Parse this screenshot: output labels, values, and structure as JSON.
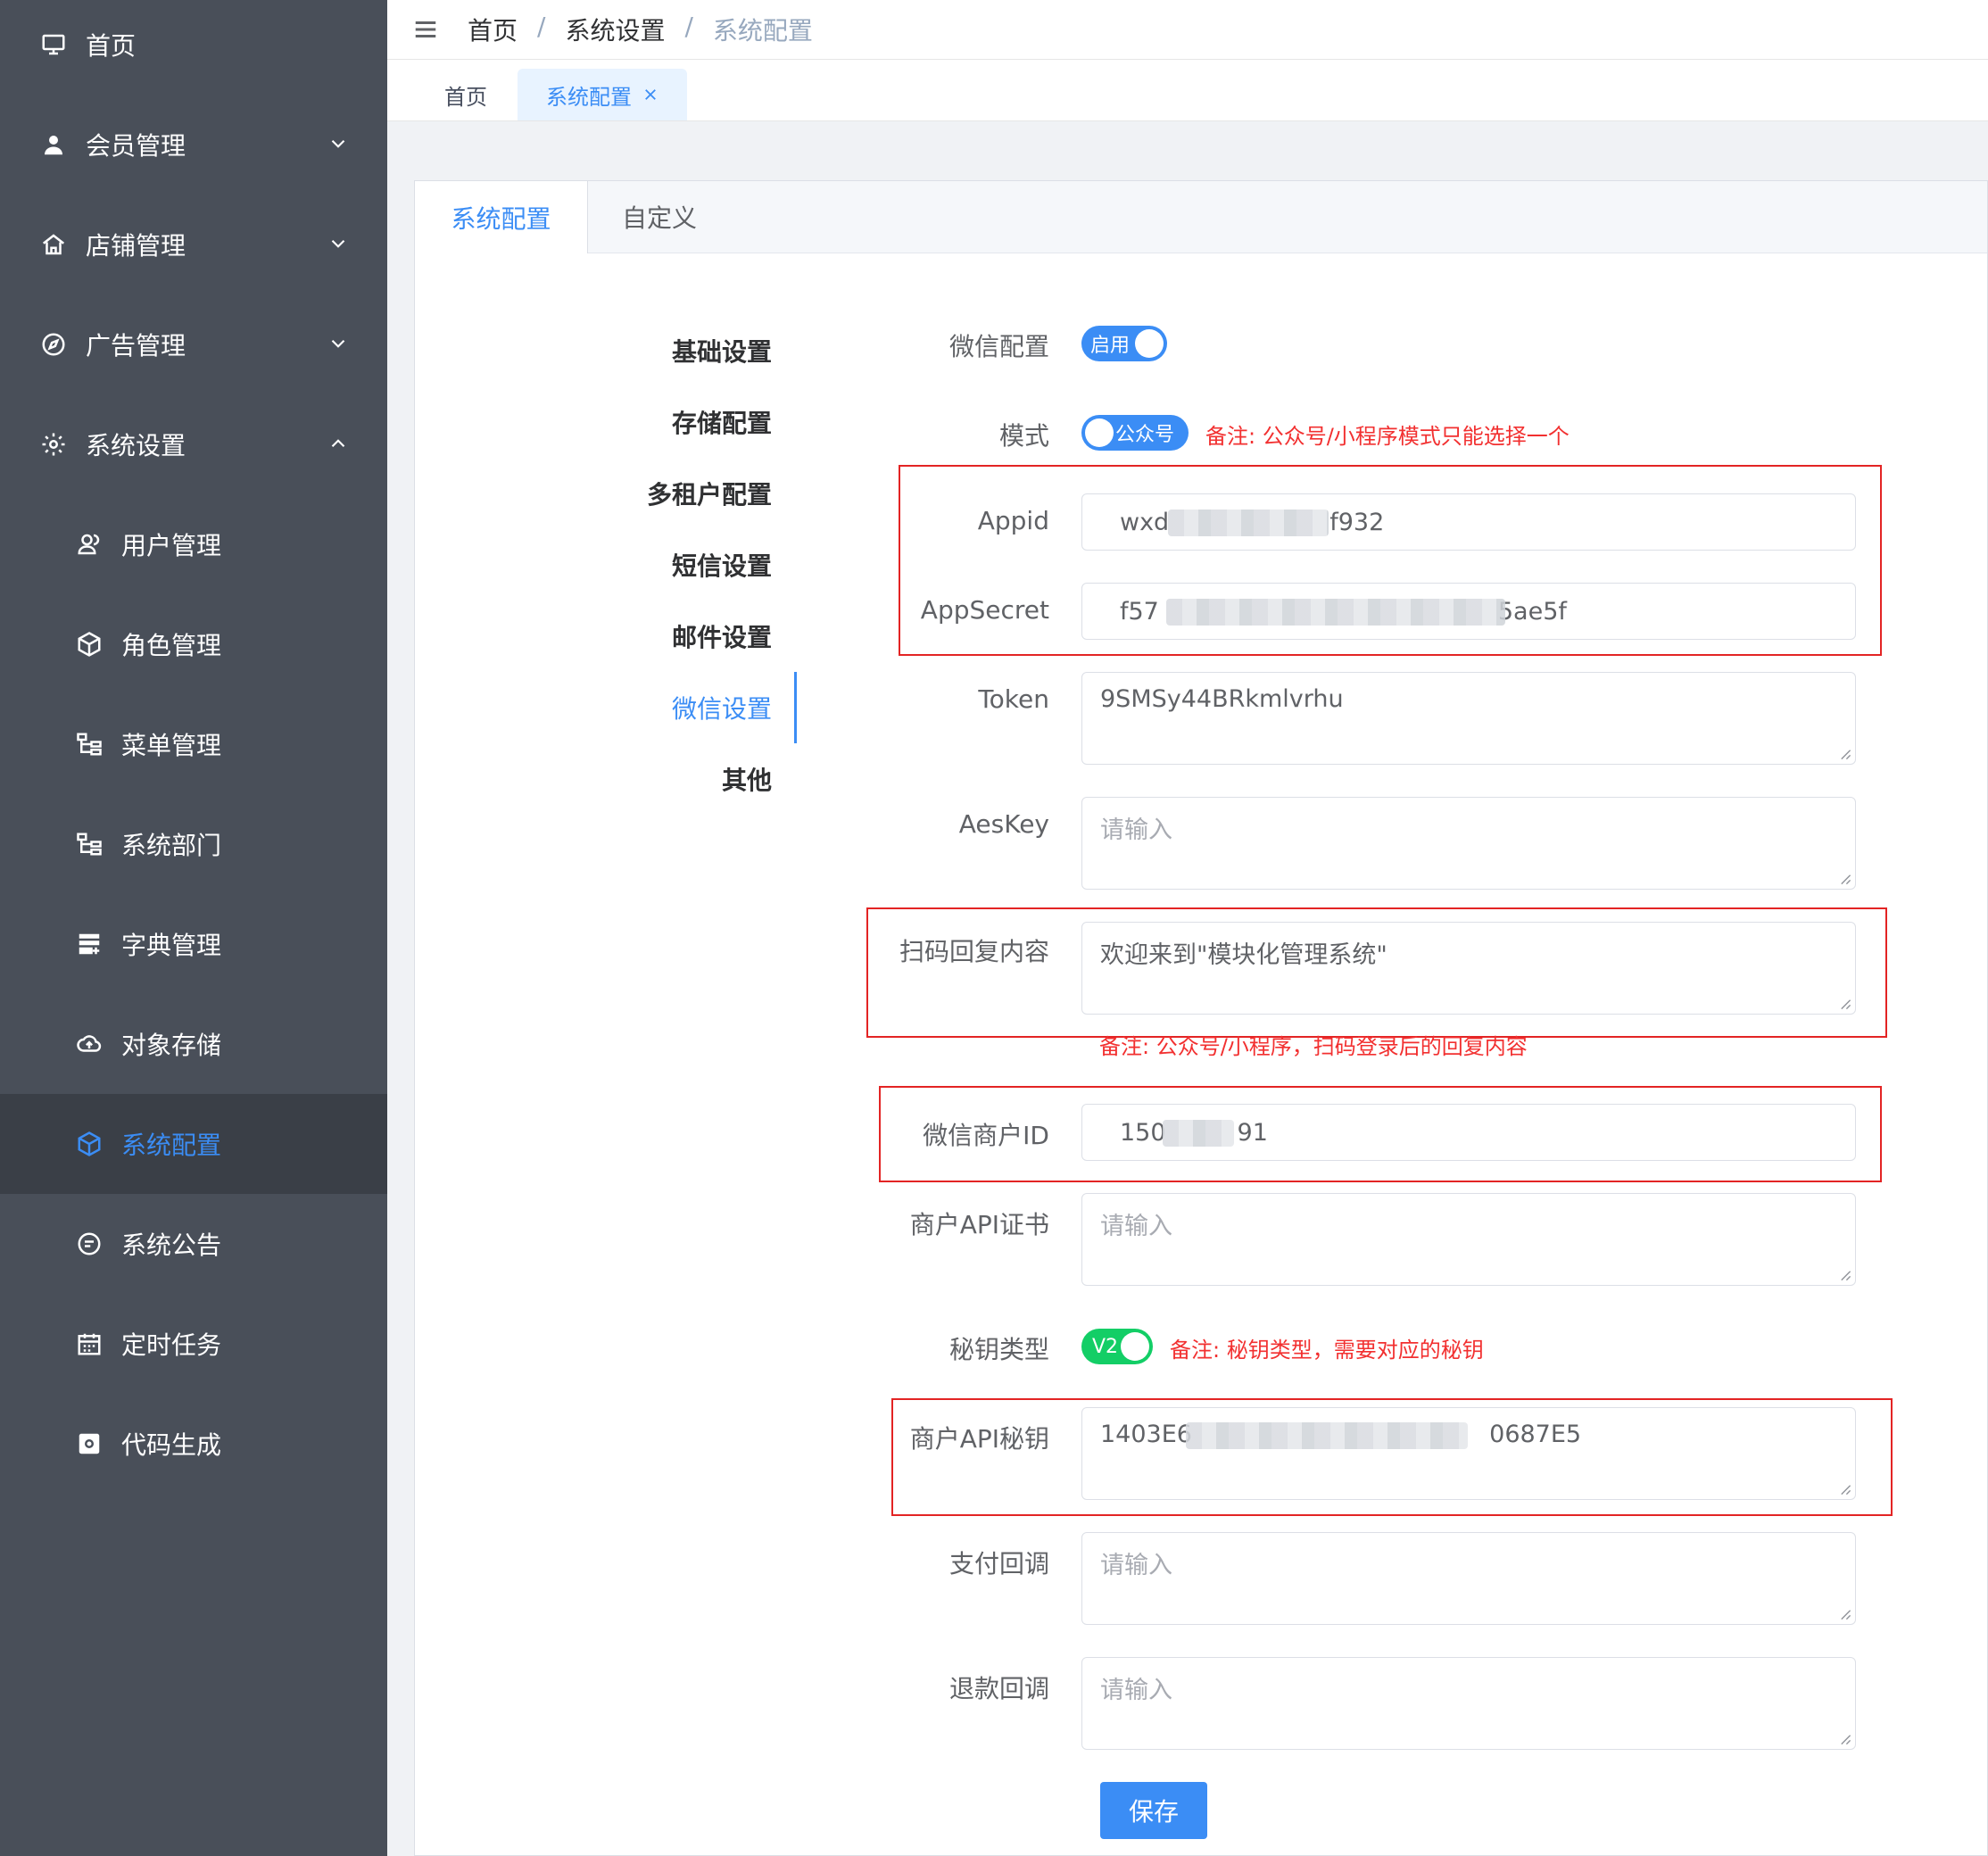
{
  "sidebar": {
    "items": [
      {
        "label": "首页",
        "icon": "monitor-icon"
      },
      {
        "label": "会员管理",
        "icon": "user-icon"
      },
      {
        "label": "店铺管理",
        "icon": "home-icon"
      },
      {
        "label": "广告管理",
        "icon": "compass-icon"
      },
      {
        "label": "系统设置",
        "icon": "gear-icon"
      },
      {
        "label": "用户管理",
        "icon": "users-icon"
      },
      {
        "label": "角色管理",
        "icon": "cube-icon"
      },
      {
        "label": "菜单管理",
        "icon": "tree-icon"
      },
      {
        "label": "系统部门",
        "icon": "tree-icon"
      },
      {
        "label": "字典管理",
        "icon": "dictionary-icon"
      },
      {
        "label": "对象存储",
        "icon": "cloud-upload-icon"
      },
      {
        "label": "系统配置",
        "icon": "cube-icon"
      },
      {
        "label": "系统公告",
        "icon": "message-icon"
      },
      {
        "label": "定时任务",
        "icon": "calendar-icon"
      },
      {
        "label": "代码生成",
        "icon": "code-icon"
      }
    ],
    "active_color": "#3b8df5",
    "background": "#494f59"
  },
  "breadcrumb": {
    "items": [
      "首页",
      "系统设置",
      "系统配置"
    ],
    "separator": "/"
  },
  "view_tabs": [
    {
      "label": "首页"
    },
    {
      "label": "系统配置"
    }
  ],
  "card_tabs": [
    {
      "label": "系统配置"
    },
    {
      "label": "自定义"
    }
  ],
  "section_nav": {
    "items": [
      "基础设置",
      "存储配置",
      "多租户配置",
      "短信设置",
      "邮件设置",
      "微信设置",
      "其他"
    ],
    "active": "微信设置"
  },
  "form": {
    "wechat_config": {
      "label": "微信配置",
      "switch_text": "启用"
    },
    "mode": {
      "label": "模式",
      "switch_text": "公众号",
      "note": "备注: 公众号/小程序模式只能选择一个"
    },
    "appid": {
      "label": "Appid",
      "value_start": "wxd",
      "value_end": "f932"
    },
    "appsecret": {
      "label": "AppSecret",
      "value_start": "f57",
      "value_end": "5ae5f"
    },
    "token": {
      "label": "Token",
      "value": "9SMSy44BRkmlvrhu"
    },
    "aeskey": {
      "label": "AesKey",
      "placeholder": "请输入"
    },
    "scan_reply": {
      "label": "扫码回复内容",
      "value": "欢迎来到\"模块化管理系统\"",
      "note": "备注: 公众号/小程序，扫码登录后的回复内容"
    },
    "merchant_id": {
      "label": "微信商户ID",
      "value_start": "150",
      "value_end": "91"
    },
    "merchant_cert": {
      "label": "商户API证书",
      "placeholder": "请输入"
    },
    "key_type": {
      "label": "秘钥类型",
      "switch_text": "V2",
      "note": "备注: 秘钥类型，需要对应的秘钥"
    },
    "merchant_key": {
      "label": "商户API秘钥",
      "value_start": "1403E6",
      "value_end": "0687E5"
    },
    "pay_callback": {
      "label": "支付回调",
      "placeholder": "请输入"
    },
    "refund_callback": {
      "label": "退款回调",
      "placeholder": "请输入"
    },
    "save_label": "保存"
  },
  "colors": {
    "primary": "#3b8df5",
    "success": "#13ce66",
    "note_red": "#f23030",
    "highlight_box": "#e32424"
  }
}
